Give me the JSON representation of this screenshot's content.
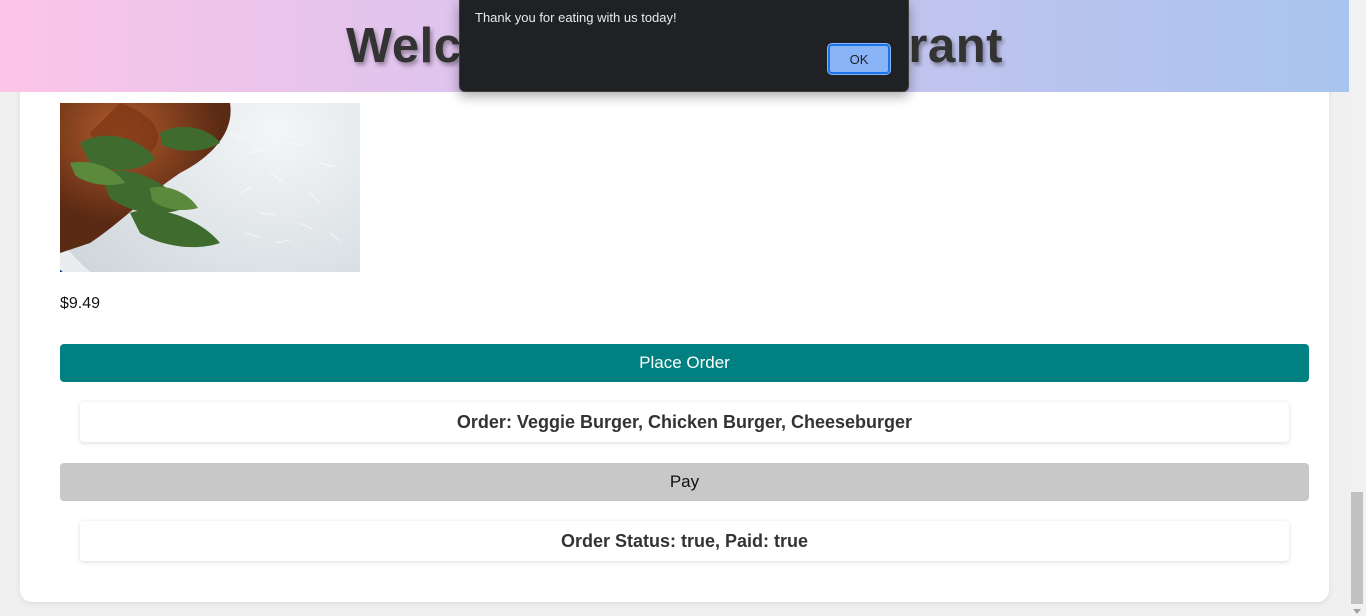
{
  "header": {
    "title": "Welcome to Our Restaurant"
  },
  "menu_item": {
    "image_alt": "plate of curry with rice and cilantro",
    "price": "$9.49"
  },
  "actions": {
    "place_order_label": "Place Order",
    "pay_label": "Pay"
  },
  "order_summary": {
    "text": "Order: Veggie Burger, Chicken Burger, Cheeseburger"
  },
  "status_summary": {
    "text": "Order Status: true, Paid: true"
  },
  "alert_dialog": {
    "message": "Thank you for eating with us today!",
    "ok_label": "OK"
  },
  "colors": {
    "primary_button": "#008080",
    "pay_button": "#c8c8c8",
    "header_gradient_start": "#fcc5e8",
    "header_gradient_end": "#a8c4ee",
    "dialog_bg": "#202124",
    "dialog_ok": "#8ab4f8"
  }
}
